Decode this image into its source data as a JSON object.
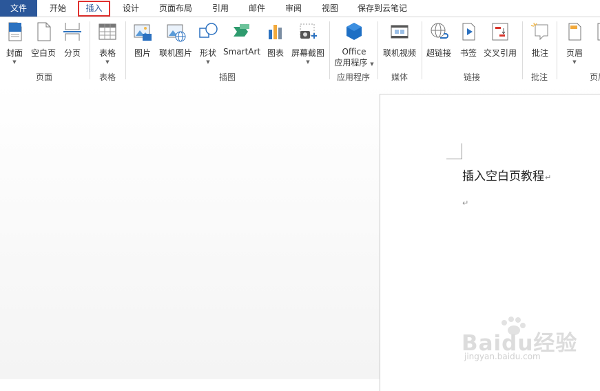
{
  "tabs": {
    "file": "文件",
    "home": "开始",
    "insert": "插入",
    "design": "设计",
    "layout": "页面布局",
    "references": "引用",
    "mailings": "邮件",
    "review": "审阅",
    "view": "视图",
    "cloud": "保存到云笔记"
  },
  "ribbon": {
    "pages": {
      "cover": "封面",
      "blank": "空白页",
      "break": "分页",
      "group": "页面"
    },
    "table": {
      "table": "表格",
      "group": "表格"
    },
    "illustrations": {
      "picture": "图片",
      "online_picture": "联机图片",
      "shapes": "形状",
      "smartart": "SmartArt",
      "chart": "图表",
      "screenshot": "屏幕截图",
      "group": "插图"
    },
    "apps": {
      "office": "Office",
      "apps": "应用程序",
      "group": "应用程序"
    },
    "media": {
      "online_video": "联机视频",
      "group": "媒体"
    },
    "links": {
      "hyperlink": "超链接",
      "bookmark": "书签",
      "crossref": "交叉引用",
      "group": "链接"
    },
    "comments": {
      "comment": "批注",
      "group": "批注"
    },
    "header": {
      "header": "页眉",
      "group": "页眉"
    }
  },
  "document": {
    "title": "插入空白页教程",
    "para_mark": "↵"
  },
  "watermark": {
    "logo": "Baidu经验",
    "url": "jingyan.baidu.com"
  },
  "colors": {
    "file_tab": "#2b579a",
    "active_outline": "#e0312f",
    "accent_blue": "#1e6fc4"
  }
}
